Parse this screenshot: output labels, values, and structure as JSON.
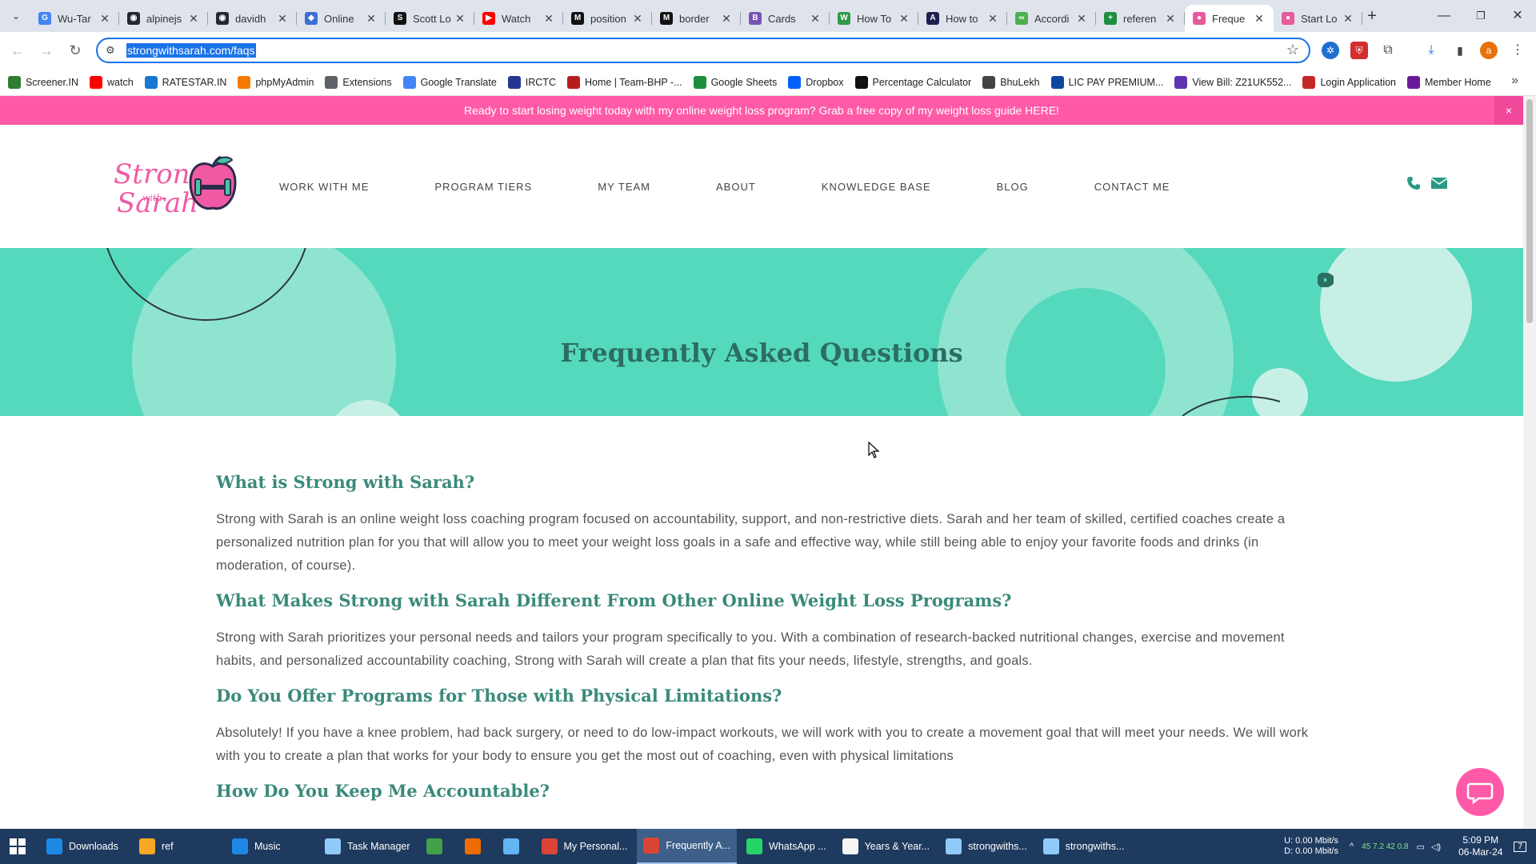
{
  "browser": {
    "tabs": [
      {
        "title": "Wu-Tar",
        "favicon_color": "#4285f4",
        "favicon_glyph": "G"
      },
      {
        "title": "alpinejs",
        "favicon_color": "#24292f",
        "favicon_glyph": "◉"
      },
      {
        "title": "davidh",
        "favicon_color": "#24292f",
        "favicon_glyph": "◉"
      },
      {
        "title": "Online",
        "favicon_color": "#3b6fd8",
        "favicon_glyph": "◆"
      },
      {
        "title": "Scott Lo",
        "favicon_color": "#111111",
        "favicon_glyph": "S"
      },
      {
        "title": "Watch",
        "favicon_color": "#ff0000",
        "favicon_glyph": "▶"
      },
      {
        "title": "position",
        "favicon_color": "#111111",
        "favicon_glyph": "M"
      },
      {
        "title": "border",
        "favicon_color": "#111111",
        "favicon_glyph": "M"
      },
      {
        "title": "Cards",
        "favicon_color": "#7952b3",
        "favicon_glyph": "B"
      },
      {
        "title": "How To",
        "favicon_color": "#2e9a4a",
        "favicon_glyph": "W"
      },
      {
        "title": "How to",
        "favicon_color": "#1f1f4f",
        "favicon_glyph": "A"
      },
      {
        "title": "Accordi",
        "favicon_color": "#4caf50",
        "favicon_glyph": "∞"
      },
      {
        "title": "referen",
        "favicon_color": "#1e8e3e",
        "favicon_glyph": "+"
      },
      {
        "title": "Freque",
        "favicon_color": "#e85a9c",
        "favicon_glyph": "●",
        "active": true
      },
      {
        "title": "Start Lo",
        "favicon_color": "#e85a9c",
        "favicon_glyph": "●"
      }
    ],
    "new_tab_label": "+",
    "url": "strongwithsarah.com/faqs",
    "profile_initial": "a",
    "bookmarks": [
      {
        "label": "Screener.IN",
        "color": "#2e7d32"
      },
      {
        "label": "watch",
        "color": "#ff0000"
      },
      {
        "label": "RATESTAR.IN",
        "color": "#1976d2"
      },
      {
        "label": "phpMyAdmin",
        "color": "#f57c00"
      },
      {
        "label": "Extensions",
        "color": "#5f6368"
      },
      {
        "label": "Google Translate",
        "color": "#4285f4"
      },
      {
        "label": "IRCTC",
        "color": "#283593"
      },
      {
        "label": "Home | Team-BHP -...",
        "color": "#b71c1c"
      },
      {
        "label": "Google Sheets",
        "color": "#1e8e3e"
      },
      {
        "label": "Dropbox",
        "color": "#0061fe"
      },
      {
        "label": "Percentage Calculator",
        "color": "#111111"
      },
      {
        "label": "BhuLekh",
        "color": "#444444"
      },
      {
        "label": "LIC PAY PREMIUM...",
        "color": "#0d47a1"
      },
      {
        "label": "View Bill: Z21UK552...",
        "color": "#5e35b1"
      },
      {
        "label": "Login Application",
        "color": "#c62828"
      },
      {
        "label": "Member Home",
        "color": "#6a1b9a"
      }
    ],
    "bookmarks_more": "»"
  },
  "site": {
    "promo_text": "Ready to start losing weight today with my online weight loss program? Grab a free copy of my weight loss guide HERE!",
    "promo_close": "×",
    "logo_line1": "Strong",
    "logo_line2": "with",
    "logo_line3": "Sarah",
    "nav": [
      {
        "label": "WORK WITH ME"
      },
      {
        "label": "PROGRAM TIERS"
      },
      {
        "label": "MY TEAM"
      },
      {
        "label": "ABOUT"
      },
      {
        "label": "KNOWLEDGE BASE"
      },
      {
        "label": "BLOG"
      },
      {
        "label": "CONTACT ME"
      }
    ],
    "hero_title": "Frequently Asked Questions",
    "faqs": [
      {
        "question": "What is Strong with Sarah?",
        "answer": "Strong with Sarah is an online weight loss coaching program focused on accountability, support, and non-restrictive diets. Sarah and her team of skilled, certified coaches create a personalized nutrition plan for you that will allow you to meet your weight loss goals in a safe and effective way, while still being able to enjoy your favorite foods and drinks (in moderation, of course)."
      },
      {
        "question": "What Makes Strong with Sarah Different From Other Online Weight Loss Programs?",
        "answer": "Strong with Sarah prioritizes your personal needs and tailors your program specifically to you. With a combination of research-backed nutritional changes, exercise and movement habits, and personalized accountability coaching, Strong with Sarah will create a plan that fits your needs, lifestyle, strengths, and goals."
      },
      {
        "question": "Do You Offer Programs for Those with Physical Limitations?",
        "answer": "Absolutely! If you have a knee problem, had back surgery, or need to do low-impact workouts, we will work with you to create a movement goal that will meet your needs. We will work with you to create a plan that works for your body to ensure you get the most out of coaching, even with physical limitations"
      },
      {
        "question": "How Do You Keep Me Accountable?",
        "answer": ""
      }
    ],
    "colors": {
      "pink": "#ff5aa8",
      "teal": "#55d9bd",
      "teal_dark": "#2c6e62",
      "question": "#3a8a7a"
    }
  },
  "taskbar": {
    "items": [
      {
        "label": "Downloads",
        "color": "#1e88e5"
      },
      {
        "label": "ref",
        "color": "#f9a825"
      },
      {
        "label": "Music",
        "color": "#1e88e5"
      },
      {
        "label": "Task Manager",
        "color": "#90caf9"
      },
      {
        "label": "",
        "color": "#43a047"
      },
      {
        "label": "",
        "color": "#ef6c00"
      },
      {
        "label": "",
        "color": "#64b5f6"
      },
      {
        "label": "My Personal...",
        "color": "#db4437"
      },
      {
        "label": "Frequently A...",
        "color": "#db4437",
        "active": true
      },
      {
        "label": "WhatsApp ...",
        "color": "#25d366"
      },
      {
        "label": "Years & Year...",
        "color": "#f5f5f5"
      },
      {
        "label": "strongwiths...",
        "color": "#90caf9"
      },
      {
        "label": "strongwiths...",
        "color": "#90caf9"
      }
    ],
    "net_up": "U:   0.00 Mbit/s",
    "net_down": "D:   0.00 Mbit/s",
    "tray_numbers": "45   7.2   42   0.8",
    "time": "5:09 PM",
    "date": "06-Mar-24",
    "notification_count": "7"
  }
}
